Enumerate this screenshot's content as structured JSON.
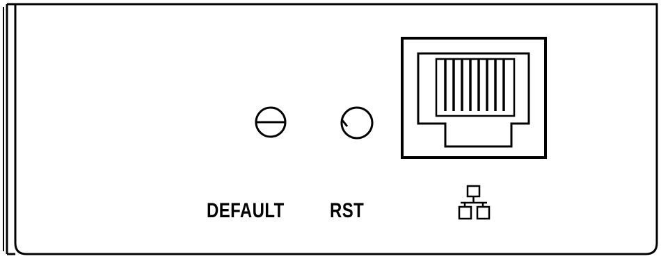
{
  "panel": {
    "labels": {
      "default_button": "DEFAULT",
      "reset_button": "RST"
    },
    "icons": {
      "port_symbol": "network-lan-icon"
    },
    "colors": {
      "ink": "#000000",
      "paper": "#ffffff"
    }
  }
}
